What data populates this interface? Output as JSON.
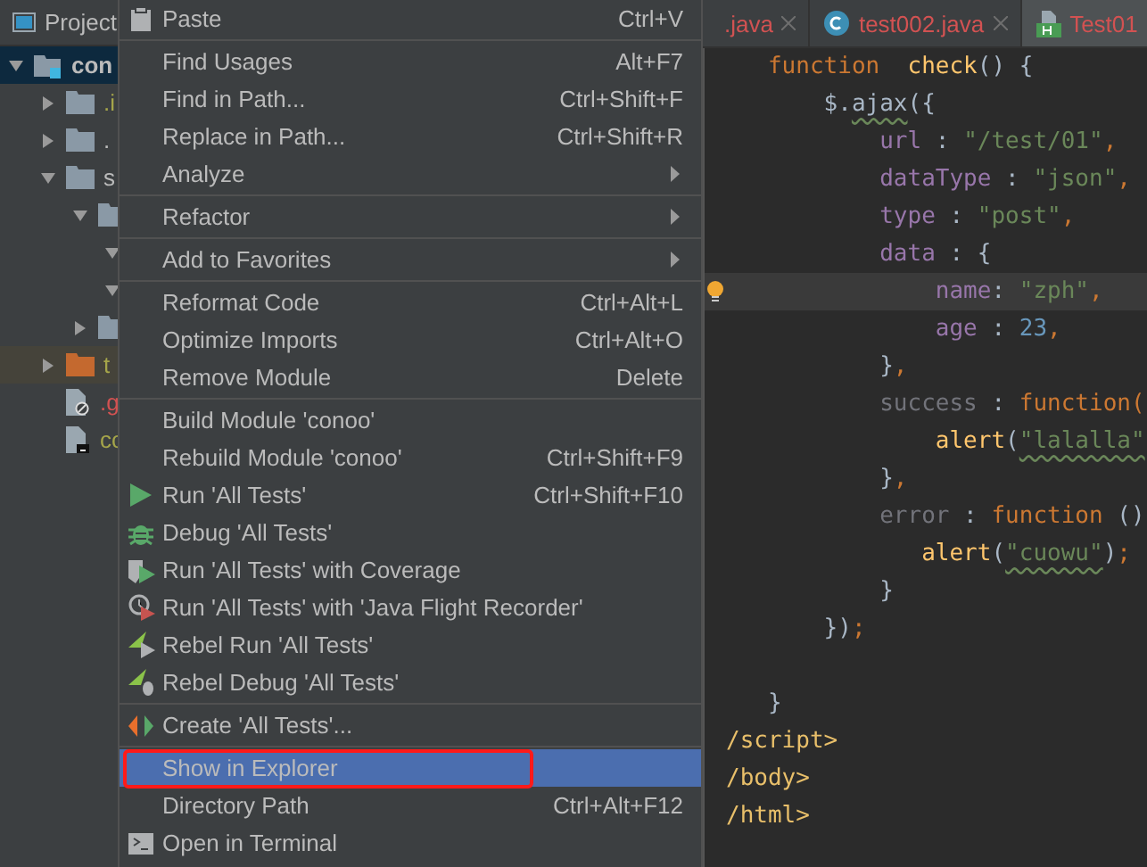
{
  "project_panel": {
    "title": "Project",
    "tree": [
      {
        "label": "con",
        "kind": "module",
        "expanded": true,
        "selected": true,
        "color": "#bbbbbb",
        "children": [
          {
            "label": ".i",
            "kind": "folder",
            "expanded": false,
            "selected": false,
            "color": "#a5a54a"
          },
          {
            "label": ".",
            "kind": "folder",
            "expanded": false,
            "selected": false
          },
          {
            "label": "s",
            "kind": "folder",
            "expanded": true,
            "selected": false,
            "color": "#bbbbbb",
            "children": [
              {
                "kind": "folder",
                "expanded": true,
                "selected": false,
                "children": [
                  {
                    "expanded": true,
                    "selected": false
                  },
                  {
                    "expanded": true,
                    "selected": false
                  }
                ]
              },
              {
                "kind": "folder",
                "expanded": false,
                "selected": false
              }
            ]
          },
          {
            "label": "t",
            "kind": "excluded-folder",
            "expanded": false,
            "selected": false,
            "color": "#a5a54a"
          },
          {
            "label": ".g",
            "kind": "ignored-file",
            "selected": false,
            "color": "#d25252"
          },
          {
            "label": "cc",
            "kind": "text-file",
            "selected": false,
            "color": "#a5a54a"
          }
        ]
      }
    ]
  },
  "editor": {
    "tabs": [
      {
        "label": ".java",
        "kind": "plain",
        "selected": false
      },
      {
        "label": "test002.java",
        "kind": "class",
        "selected": false
      },
      {
        "label": "Test01",
        "kind": "html",
        "selected": true
      }
    ],
    "lines": [
      {
        "current": false,
        "tokens": [
          {
            "kind": "keyword",
            "text": "   function"
          },
          {
            "kind": "fn",
            "text": "  check"
          },
          {
            "kind": "plain",
            "text": "() {"
          }
        ]
      },
      {
        "current": false,
        "tokens": [
          {
            "kind": "plain",
            "text": "       $."
          },
          {
            "kind": "plain",
            "text": "ajax",
            "warning": true
          },
          {
            "kind": "plain",
            "text": "({"
          }
        ]
      },
      {
        "current": false,
        "tokens": [
          {
            "kind": "prop",
            "text": "           url"
          },
          {
            "kind": "plain",
            "text": " : "
          },
          {
            "kind": "string",
            "text": "\"/test/01\""
          },
          {
            "kind": "keyword",
            "text": ","
          }
        ]
      },
      {
        "current": false,
        "tokens": [
          {
            "kind": "prop",
            "text": "           dataType"
          },
          {
            "kind": "plain",
            "text": " : "
          },
          {
            "kind": "string",
            "text": "\"json\""
          },
          {
            "kind": "keyword",
            "text": ","
          }
        ]
      },
      {
        "current": false,
        "tokens": [
          {
            "kind": "prop",
            "text": "           type"
          },
          {
            "kind": "plain",
            "text": " : "
          },
          {
            "kind": "string",
            "text": "\"post\""
          },
          {
            "kind": "keyword",
            "text": ","
          }
        ]
      },
      {
        "current": false,
        "tokens": [
          {
            "kind": "prop",
            "text": "           data"
          },
          {
            "kind": "plain",
            "text": " : {"
          }
        ]
      },
      {
        "current": true,
        "tokens": [
          {
            "kind": "prop",
            "text": "               name"
          },
          {
            "kind": "plain",
            "text": ": "
          },
          {
            "kind": "string",
            "text": "\"zph\""
          },
          {
            "kind": "keyword",
            "text": ","
          }
        ]
      },
      {
        "current": false,
        "tokens": [
          {
            "kind": "prop",
            "text": "               age"
          },
          {
            "kind": "plain",
            "text": " : "
          },
          {
            "kind": "number",
            "text": "23"
          },
          {
            "kind": "keyword",
            "text": ","
          }
        ]
      },
      {
        "current": false,
        "tokens": [
          {
            "kind": "plain",
            "text": "           }"
          },
          {
            "kind": "keyword",
            "text": ","
          }
        ]
      },
      {
        "current": false,
        "tokens": [
          {
            "kind": "unused",
            "text": "           success"
          },
          {
            "kind": "plain",
            "text": " : "
          },
          {
            "kind": "keyword",
            "text": "function("
          }
        ]
      },
      {
        "current": false,
        "tokens": [
          {
            "kind": "fn",
            "text": "               alert"
          },
          {
            "kind": "plain",
            "text": "("
          },
          {
            "kind": "string",
            "text": "\"lalalla\"",
            "warning": true
          }
        ]
      },
      {
        "current": false,
        "tokens": [
          {
            "kind": "plain",
            "text": "           }"
          },
          {
            "kind": "keyword",
            "text": ","
          }
        ]
      },
      {
        "current": false,
        "tokens": [
          {
            "kind": "unused",
            "text": "           error"
          },
          {
            "kind": "plain",
            "text": " : "
          },
          {
            "kind": "keyword",
            "text": "function"
          },
          {
            "kind": "plain",
            "text": " ()"
          }
        ]
      },
      {
        "current": false,
        "tokens": [
          {
            "kind": "fn",
            "text": "              alert"
          },
          {
            "kind": "plain",
            "text": "("
          },
          {
            "kind": "string",
            "text": "\"cuowu\"",
            "warning": true
          },
          {
            "kind": "plain",
            "text": ")"
          },
          {
            "kind": "keyword",
            "text": ";"
          }
        ]
      },
      {
        "current": false,
        "tokens": [
          {
            "kind": "plain",
            "text": "           }"
          }
        ]
      },
      {
        "current": false,
        "tokens": [
          {
            "kind": "plain",
            "text": "       })"
          },
          {
            "kind": "keyword",
            "text": ";"
          }
        ]
      },
      {
        "current": false
      },
      {
        "current": false,
        "tokens": [
          {
            "kind": "plain",
            "text": "   }"
          }
        ]
      },
      {
        "current": false,
        "tokens": [
          {
            "kind": "tag",
            "text": "/script>"
          }
        ]
      },
      {
        "current": false,
        "tokens": [
          {
            "kind": "tag",
            "text": "/body>"
          }
        ]
      },
      {
        "current": false,
        "tokens": [
          {
            "kind": "tag",
            "text": "/html>"
          }
        ]
      }
    ]
  },
  "context_menu": {
    "groups": [
      [
        {
          "label": "Paste",
          "shortcut": "Ctrl+V",
          "kind": "clipboard",
          "submenu": false,
          "selected": false,
          "outlined": false
        }
      ],
      [
        {
          "label": "Find Usages",
          "shortcut": "Alt+F7",
          "kind": "text",
          "submenu": false,
          "selected": false,
          "outlined": false
        },
        {
          "label": "Find in Path...",
          "shortcut": "Ctrl+Shift+F",
          "kind": "text",
          "submenu": false,
          "selected": false,
          "outlined": false
        },
        {
          "label": "Replace in Path...",
          "shortcut": "Ctrl+Shift+R",
          "kind": "text",
          "submenu": false,
          "selected": false,
          "outlined": false
        },
        {
          "label": "Analyze",
          "kind": "text",
          "submenu": true,
          "selected": false,
          "outlined": false
        }
      ],
      [
        {
          "label": "Refactor",
          "kind": "text",
          "submenu": true,
          "selected": false,
          "outlined": false
        }
      ],
      [
        {
          "label": "Add to Favorites",
          "kind": "text",
          "submenu": true,
          "selected": false,
          "outlined": false
        }
      ],
      [
        {
          "label": "Reformat Code",
          "shortcut": "Ctrl+Alt+L",
          "kind": "text",
          "submenu": false,
          "selected": false,
          "outlined": false
        },
        {
          "label": "Optimize Imports",
          "shortcut": "Ctrl+Alt+O",
          "kind": "text",
          "submenu": false,
          "selected": false,
          "outlined": false
        },
        {
          "label": "Remove Module",
          "shortcut": "Delete",
          "kind": "text",
          "submenu": false,
          "selected": false,
          "outlined": false
        }
      ],
      [
        {
          "label": "Build Module 'conoo'",
          "kind": "text",
          "submenu": false,
          "selected": false,
          "outlined": false
        },
        {
          "label": "Rebuild Module 'conoo'",
          "shortcut": "Ctrl+Shift+F9",
          "kind": "text",
          "submenu": false,
          "selected": false,
          "outlined": false
        },
        {
          "label": "Run 'All Tests'",
          "shortcut": "Ctrl+Shift+F10",
          "kind": "run",
          "submenu": false,
          "selected": false,
          "outlined": false
        },
        {
          "label": "Debug 'All Tests'",
          "kind": "debug",
          "submenu": false,
          "selected": false,
          "outlined": false
        },
        {
          "label": "Run 'All Tests' with Coverage",
          "kind": "coverage",
          "submenu": false,
          "selected": false,
          "outlined": false
        },
        {
          "label": "Run 'All Tests' with 'Java Flight Recorder'",
          "kind": "recorder",
          "submenu": false,
          "selected": false,
          "outlined": false
        },
        {
          "label": "Rebel Run 'All Tests'",
          "kind": "rebel-run",
          "submenu": false,
          "selected": false,
          "outlined": false
        },
        {
          "label": "Rebel Debug 'All Tests'",
          "kind": "rebel-debug",
          "submenu": false,
          "selected": false,
          "outlined": false
        }
      ],
      [
        {
          "label": "Create 'All Tests'...",
          "kind": "create",
          "submenu": false,
          "selected": false,
          "outlined": false
        }
      ],
      [
        {
          "label": "Show in Explorer",
          "kind": "text",
          "submenu": false,
          "selected": true,
          "outlined": true
        },
        {
          "label": "Directory Path",
          "shortcut": "Ctrl+Alt+F12",
          "kind": "text",
          "submenu": false,
          "selected": false,
          "outlined": false
        },
        {
          "label": "Open in Terminal",
          "kind": "terminal",
          "submenu": false,
          "selected": false,
          "outlined": false
        }
      ]
    ]
  }
}
